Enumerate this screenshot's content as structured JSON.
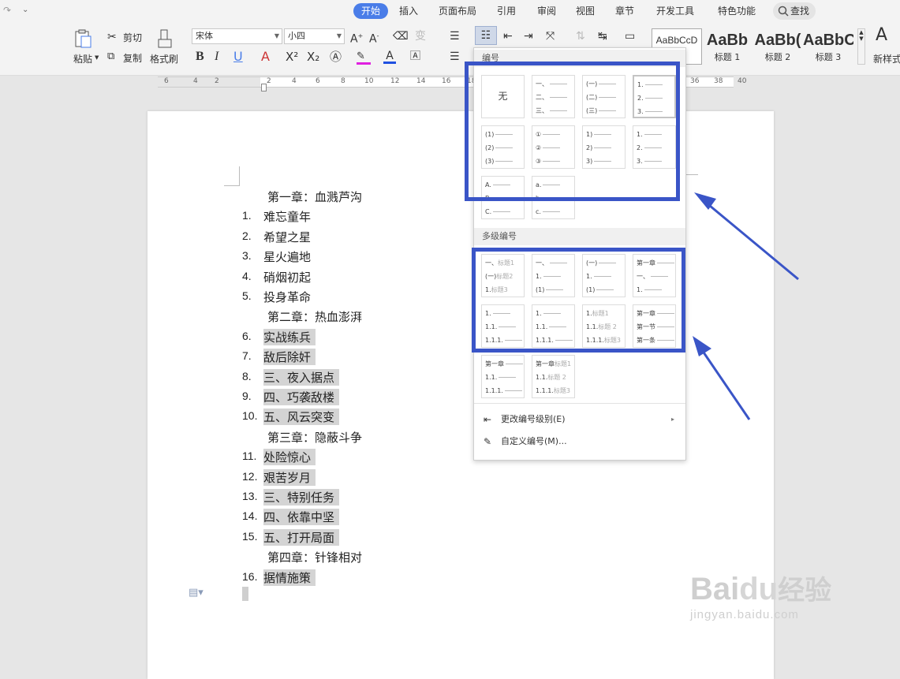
{
  "tabs": [
    "开始",
    "插入",
    "页面布局",
    "引用",
    "审阅",
    "视图",
    "章节",
    "开发工具",
    "特色功能"
  ],
  "search_label": "查找",
  "clipboard": {
    "paste": "粘贴",
    "cut": "剪切",
    "copy": "复制",
    "painter": "格式刷"
  },
  "font": {
    "name": "宋体",
    "size": "小四"
  },
  "styles": [
    {
      "preview": "AaBbCcD",
      "caption": ""
    },
    {
      "preview": "AaBb",
      "caption": "标题 1"
    },
    {
      "preview": "AaBb(",
      "caption": "标题 2"
    },
    {
      "preview": "AaBbC",
      "caption": "标题 3"
    }
  ],
  "new_style": "新样式",
  "ruler": [
    "6",
    "4",
    "2",
    "2",
    "4",
    "6",
    "8",
    "10",
    "12",
    "14",
    "16",
    "18",
    "36",
    "38",
    "40"
  ],
  "document": {
    "lines": [
      {
        "type": "chapter",
        "text": "第一章：血溅芦沟"
      },
      {
        "type": "item",
        "num": "1.",
        "text": "难忘童年",
        "hl": false
      },
      {
        "type": "item",
        "num": "2.",
        "text": "希望之星",
        "hl": false
      },
      {
        "type": "item",
        "num": "3.",
        "text": "星火遍地",
        "hl": false
      },
      {
        "type": "item",
        "num": "4.",
        "text": "硝烟初起",
        "hl": false
      },
      {
        "type": "item",
        "num": "5.",
        "text": "投身革命",
        "hl": false
      },
      {
        "type": "chapter",
        "text": "第二章：热血澎湃"
      },
      {
        "type": "item",
        "num": "6.",
        "text": "实战练兵",
        "hl": true
      },
      {
        "type": "item",
        "num": "7.",
        "text": "敌后除奸",
        "hl": true
      },
      {
        "type": "item",
        "num": "8.",
        "text": "三、夜入据点",
        "hl": true
      },
      {
        "type": "item",
        "num": "9.",
        "text": "四、巧袭敌楼",
        "hl": true
      },
      {
        "type": "item",
        "num": "10.",
        "text": "五、风云突变",
        "hl": true
      },
      {
        "type": "chapter",
        "text": "第三章：隐蔽斗争"
      },
      {
        "type": "item",
        "num": "11.",
        "text": "处险惊心",
        "hl": true
      },
      {
        "type": "item",
        "num": "12.",
        "text": "艰苦岁月",
        "hl": true
      },
      {
        "type": "item",
        "num": "13.",
        "text": "三、特别任务",
        "hl": true
      },
      {
        "type": "item",
        "num": "14.",
        "text": "四、依靠中坚",
        "hl": true
      },
      {
        "type": "item",
        "num": "15.",
        "text": "五、打开局面",
        "hl": true
      },
      {
        "type": "chapter",
        "text": "第四章：针锋相对"
      },
      {
        "type": "item",
        "num": "16.",
        "text": "据情施策",
        "hl": true
      }
    ]
  },
  "menu": {
    "section_numbering": "编号",
    "section_multilevel": "多级编号",
    "none_label": "无",
    "change_level": "更改编号级别(E)",
    "custom": "自定义编号(M)...",
    "single": [
      [
        [
          "无"
        ]
      ],
      [
        [
          "一、"
        ],
        [
          "二、"
        ],
        [
          "三、"
        ]
      ],
      [
        [
          "(一)"
        ],
        [
          "(二)"
        ],
        [
          "(三)"
        ]
      ],
      [
        [
          "1."
        ],
        [
          "2."
        ],
        [
          "3."
        ]
      ],
      [
        [
          "(1)"
        ],
        [
          "(2)"
        ],
        [
          "(3)"
        ]
      ],
      [
        [
          "①"
        ],
        [
          "②"
        ],
        [
          "③"
        ]
      ],
      [
        [
          "1)"
        ],
        [
          "2)"
        ],
        [
          "3)"
        ]
      ],
      [
        [
          "1."
        ],
        [
          "2."
        ],
        [
          "3."
        ]
      ],
      [
        [
          "A."
        ],
        [
          "B."
        ],
        [
          "C."
        ]
      ],
      [
        [
          "a."
        ],
        [
          "b."
        ],
        [
          "c."
        ]
      ]
    ],
    "multi": [
      [
        [
          "一、",
          "标题1"
        ],
        [
          "(一)",
          "标题2"
        ],
        [
          "1.",
          "标题3"
        ]
      ],
      [
        [
          "一、",
          ""
        ],
        [
          "1.",
          ""
        ],
        [
          "(1)",
          ""
        ]
      ],
      [
        [
          "(一)",
          ""
        ],
        [
          "1.",
          ""
        ],
        [
          "(1)",
          ""
        ]
      ],
      [
        [
          "第一章",
          ""
        ],
        [
          "一、",
          ""
        ],
        [
          "1.",
          ""
        ]
      ],
      [
        [
          "1.",
          ""
        ],
        [
          "1.1.",
          ""
        ],
        [
          "1.1.1.",
          ""
        ]
      ],
      [
        [
          "1.",
          ""
        ],
        [
          "1.1.",
          ""
        ],
        [
          "1.1.1.",
          ""
        ]
      ],
      [
        [
          "1.",
          "标题1"
        ],
        [
          "1.1.",
          "标题 2"
        ],
        [
          "1.1.1.",
          "标题3"
        ]
      ],
      [
        [
          "第一章",
          ""
        ],
        [
          "第一节",
          ""
        ],
        [
          "第一条",
          ""
        ]
      ],
      [
        [
          "第一章",
          ""
        ],
        [
          "1.1.",
          ""
        ],
        [
          "1.1.1.",
          ""
        ]
      ],
      [
        [
          "第一章",
          "标题1"
        ],
        [
          "1.1.",
          "标题 2"
        ],
        [
          "1.1.1.",
          "标题3"
        ]
      ]
    ]
  },
  "watermark": {
    "brand": "Bai",
    "brand2": "du",
    "cn": "经验",
    "url": "jingyan.baidu.com"
  },
  "colors": {
    "accent": "#4a7de8",
    "box": "#3a55c7",
    "highlight": "#d4d4d4"
  }
}
